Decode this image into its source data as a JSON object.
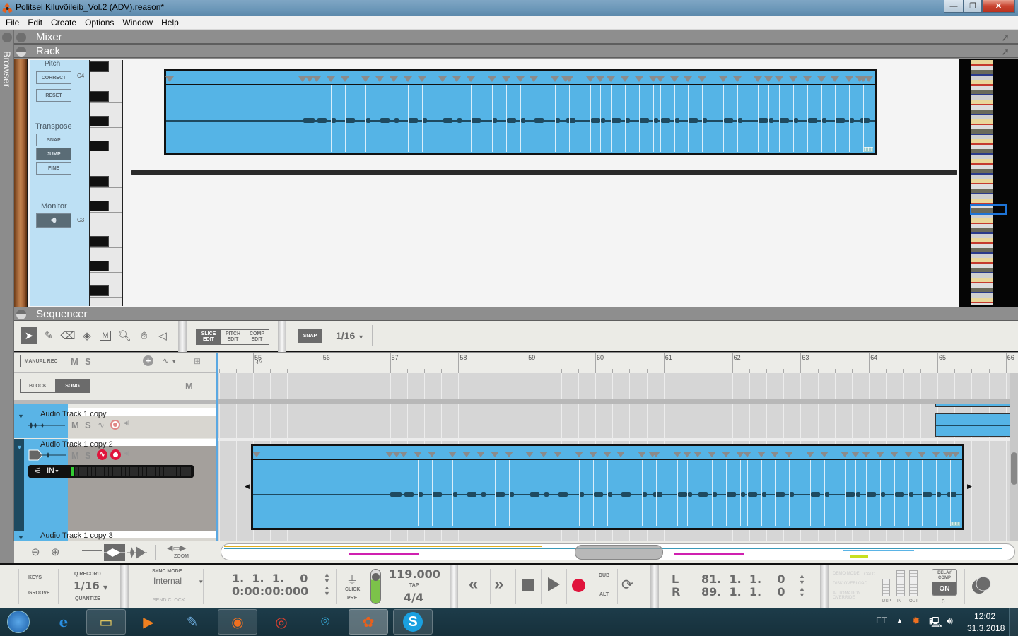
{
  "window": {
    "title": "Politsei Kiluvõileib_Vol.2 (ADV).reason*",
    "minimize": "—",
    "maximize": "❐",
    "close": "✕"
  },
  "menu": [
    "File",
    "Edit",
    "Create",
    "Options",
    "Window",
    "Help"
  ],
  "browser": {
    "label": "Browser"
  },
  "panels": {
    "mixer": "Mixer",
    "rack": "Rack",
    "sequencer": "Sequencer"
  },
  "rack_device": {
    "pitch_label": "Pitch",
    "correct": "CORRECT",
    "reset": "RESET",
    "transpose_label": "Transpose",
    "transpose_options": [
      "SNAP",
      "JUMP",
      "FINE"
    ],
    "transpose_selected": "JUMP",
    "monitor_label": "Monitor",
    "monitor_icon": "speaker-icon",
    "note_high": "C4",
    "note_low": "C3"
  },
  "toolbar": {
    "tools": [
      "select-arrow",
      "pencil",
      "eraser",
      "razor",
      "mute-tool",
      "magnify",
      "hand",
      "speaker"
    ],
    "edit_modes": [
      {
        "l1": "SLICE",
        "l2": "EDIT",
        "active": true
      },
      {
        "l1": "PITCH",
        "l2": "EDIT",
        "active": false
      },
      {
        "l1": "COMP",
        "l2": "EDIT",
        "active": false
      }
    ],
    "snap_label": "SNAP",
    "snap_value": "1/16"
  },
  "track_header": {
    "manual_rec": "MANUAL REC",
    "mute": "M",
    "solo": "S",
    "block": "BLOCK",
    "song": "SONG",
    "song_mode_selected": "SONG",
    "transport_mute": "M"
  },
  "ruler": {
    "bars": [
      "55",
      "56",
      "57",
      "58",
      "59",
      "60",
      "61",
      "62",
      "63",
      "64",
      "65",
      "66"
    ],
    "time_signature": "4/4"
  },
  "tracks": [
    {
      "name": "Audio Track 1 copy",
      "mute": "M",
      "solo": "S",
      "record_armed": false
    },
    {
      "name": "Audio Track 1 copy 2",
      "mute": "M",
      "solo": "S",
      "record_armed": true,
      "input": "IN",
      "level": 0.03
    },
    {
      "name": "Audio Track 1 copy 3"
    }
  ],
  "zoom": {
    "label": "ZOOM"
  },
  "transport": {
    "keys": "KEYS",
    "groove": "GROOVE",
    "q_record": "Q RECORD",
    "quantize_value": "1/16",
    "quantize": "QUANTIZE",
    "sync_mode_label": "SYNC MODE",
    "sync_mode": "Internal",
    "send_clock": "SEND CLOCK",
    "position_bars": "1.  1.  1.    0",
    "position_time": "0:00:00:000",
    "click": "CLICK",
    "pre": "PRE",
    "tempo": "119.000",
    "tap": "TAP",
    "signature": "4/4",
    "dub": "DUB",
    "alt": "ALT",
    "loop_left_label": "L",
    "loop_left": "81.  1.  1.    0",
    "loop_right_label": "R",
    "loop_right": "89.  1.  1.    0",
    "demo_mode": "DEMO MODE",
    "calc": "CALC",
    "disk_overload": "DISK OVERLOAD",
    "automation_override": "AUTOMATION OVERRIDE",
    "dsp": "DSP",
    "in": "IN",
    "out": "OUT",
    "delay_comp": "DELAY COMP",
    "delay_comp_state": "ON",
    "delay_comp_value": "0"
  },
  "taskbar": {
    "apps": [
      "start",
      "internet-explorer",
      "file-explorer",
      "media-player",
      "user-app",
      "firefox",
      "chrome",
      "camera-app",
      "reason",
      "skype"
    ],
    "language": "ET",
    "time": "12:02",
    "date": "31.3.2018"
  },
  "colors": {
    "clip": "#55b4e6",
    "record": "#e0143c",
    "accent": "#5aa8e2"
  }
}
